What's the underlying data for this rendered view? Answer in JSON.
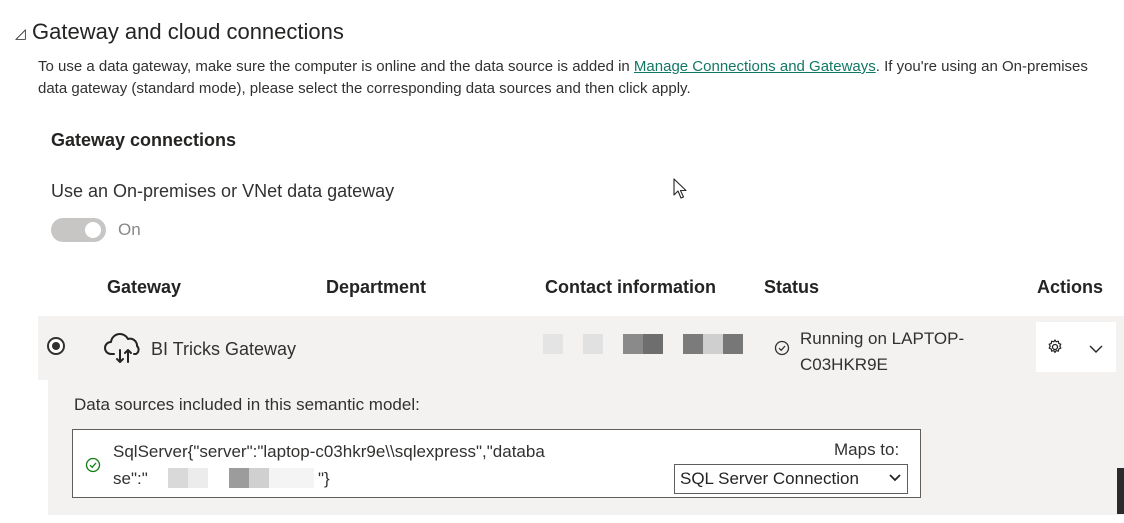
{
  "section": {
    "title": "Gateway and cloud connections",
    "description_before": "To use a data gateway, make sure the computer is online and the data source is added in ",
    "description_link": "Manage Connections and Gateways",
    "description_after": ". If you're using an On-premises data gateway (standard mode), please select the corresponding data sources and then click apply."
  },
  "gateway_connections": {
    "heading": "Gateway connections",
    "use_label": "Use an On-premises or VNet data gateway",
    "toggle_label": "On"
  },
  "table": {
    "columns": [
      "Gateway",
      "Department",
      "Contact information",
      "Status",
      "Actions"
    ],
    "row": {
      "name": "BI Tricks Gateway",
      "status": "Running on LAPTOP-C03HKR9E"
    }
  },
  "data_sources": {
    "label": "Data sources included in this semantic model:",
    "source_line1": "SqlServer{\"server\":\"laptop-c03hkr9e\\\\sqlexpress\",\"databa",
    "source_line2": "se\":\"",
    "source_end": "\"}",
    "maps_to_label": "Maps to:",
    "maps_to_value": "SQL Server Connection"
  },
  "colors": {
    "link": "#117865",
    "row_bg": "#f3f2f1",
    "status_ok": "#107c10"
  },
  "icons": [
    "collapse-triangle-icon",
    "cloud-gateway-icon",
    "status-check-icon",
    "gear-icon",
    "chevron-down-icon",
    "success-check-icon",
    "mouse-cursor-icon"
  ]
}
